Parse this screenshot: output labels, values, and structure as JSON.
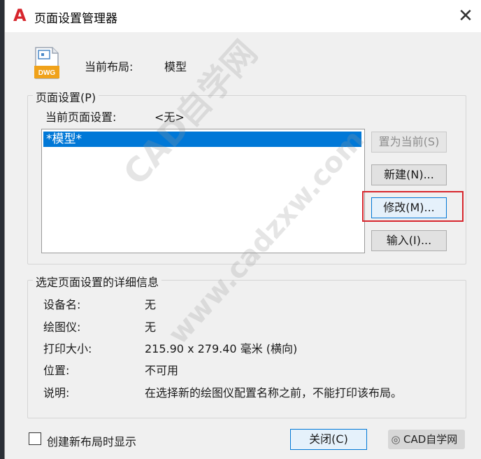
{
  "window": {
    "title": "页面设置管理器",
    "close_glyph": "✕"
  },
  "header": {
    "current_layout_label": "当前布局:",
    "current_layout_value": "模型",
    "icon_text": "DWG"
  },
  "page_setup": {
    "group_title": "页面设置(P)",
    "current_label": "当前页面设置:",
    "current_value": "<无>",
    "list_items": [
      "*模型*"
    ]
  },
  "buttons": {
    "set_current": "置为当前(S)",
    "new": "新建(N)...",
    "modify": "修改(M)...",
    "import": "输入(I)...",
    "close": "关闭(C)"
  },
  "details": {
    "group_title": "选定页面设置的详细信息",
    "rows": [
      {
        "label": "设备名:",
        "value": "无"
      },
      {
        "label": "绘图仪:",
        "value": "无"
      },
      {
        "label": "打印大小:",
        "value": "215.90 x 279.40 毫米 (横向)"
      },
      {
        "label": "位置:",
        "value": "不可用"
      },
      {
        "label": "说明:",
        "value": "在选择新的绘图仪配置名称之前，不能打印该布局。"
      }
    ]
  },
  "footer": {
    "checkbox_label": "创建新布局时显示",
    "checkbox_checked": false
  },
  "watermark": {
    "line1": "CAD自学网",
    "line2": "www.cadzxw.com"
  },
  "badge": {
    "text": "CAD自学网"
  },
  "colors": {
    "selection": "#0078d7",
    "highlight_box": "#d7262d",
    "app_icon": "#d7262d"
  }
}
